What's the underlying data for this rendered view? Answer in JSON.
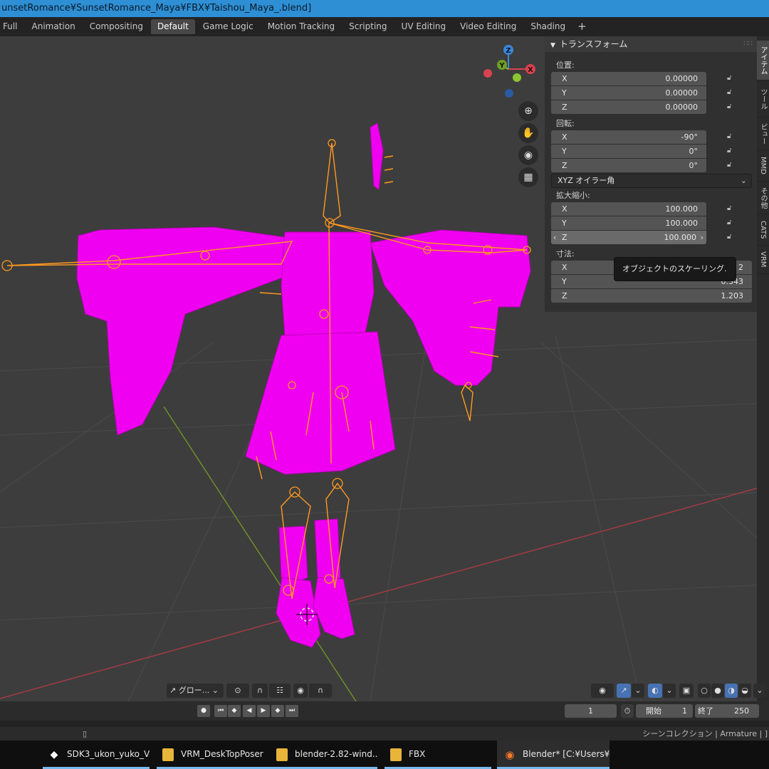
{
  "window": {
    "title": "unsetRomance¥SunsetRomance_Maya¥FBX¥Taishou_Maya_.blend]"
  },
  "workspace_tabs": [
    {
      "label": "Full"
    },
    {
      "label": "Animation"
    },
    {
      "label": "Compositing"
    },
    {
      "label": "Default"
    },
    {
      "label": "Game Logic"
    },
    {
      "label": "Motion Tracking"
    },
    {
      "label": "Scripting"
    },
    {
      "label": "UV Editing"
    },
    {
      "label": "Video Editing"
    },
    {
      "label": "Shading"
    }
  ],
  "active_tab": "Default",
  "add_tab_label": "+",
  "gizmo": {
    "x": "X",
    "y": "Y",
    "z": "Z"
  },
  "transform_panel": {
    "header": "トランスフォーム",
    "location": {
      "label": "位置:",
      "fields": [
        {
          "axis": "X",
          "value": "0.00000"
        },
        {
          "axis": "Y",
          "value": "0.00000"
        },
        {
          "axis": "Z",
          "value": "0.00000"
        }
      ]
    },
    "rotation": {
      "label": "回転:",
      "fields": [
        {
          "axis": "X",
          "value": "-90°"
        },
        {
          "axis": "Y",
          "value": "0°"
        },
        {
          "axis": "Z",
          "value": "0°"
        }
      ]
    },
    "rotation_mode": "XYZ オイラー角",
    "scale": {
      "label": "拡大縮小:",
      "fields": [
        {
          "axis": "X",
          "value": "100.000"
        },
        {
          "axis": "Y",
          "value": "100.000"
        },
        {
          "axis": "Z",
          "value": "100.000"
        }
      ]
    },
    "dimensions": {
      "label": "寸法:",
      "fields": [
        {
          "axis": "X",
          "value": "2"
        },
        {
          "axis": "Y",
          "value": "0.343"
        },
        {
          "axis": "Z",
          "value": "1.203"
        }
      ]
    }
  },
  "tooltip": "オブジェクトのスケーリング.",
  "side_tabs": [
    {
      "label": "アイテム"
    },
    {
      "label": "ツール"
    },
    {
      "label": "ビュー"
    },
    {
      "label": "MMD"
    },
    {
      "label": "その他"
    },
    {
      "label": "CATS"
    },
    {
      "label": "VRM"
    }
  ],
  "viewport_header": {
    "orientation": "グロー..."
  },
  "timeline": {
    "current_frame": "1",
    "start_label": "開始",
    "start_value": "1",
    "end_label": "終了",
    "end_value": "250"
  },
  "status_bar": {
    "right_text": "シーンコレクション | Armature | ]"
  },
  "taskbar": [
    {
      "label": "SDK3_ukon_yuko_V..."
    },
    {
      "label": "VRM_DeskTopPoser"
    },
    {
      "label": "blender-2.82-wind..."
    },
    {
      "label": "FBX"
    },
    {
      "label": "Blender* [C:¥Users¥..."
    }
  ],
  "colors": {
    "mesh": "#ff00ff",
    "bones": "#ff9a1f",
    "x_axis": "#d9424f",
    "y_axis": "#8ac530",
    "z_axis": "#3d86d8",
    "selection_blue": "#4772b3"
  }
}
